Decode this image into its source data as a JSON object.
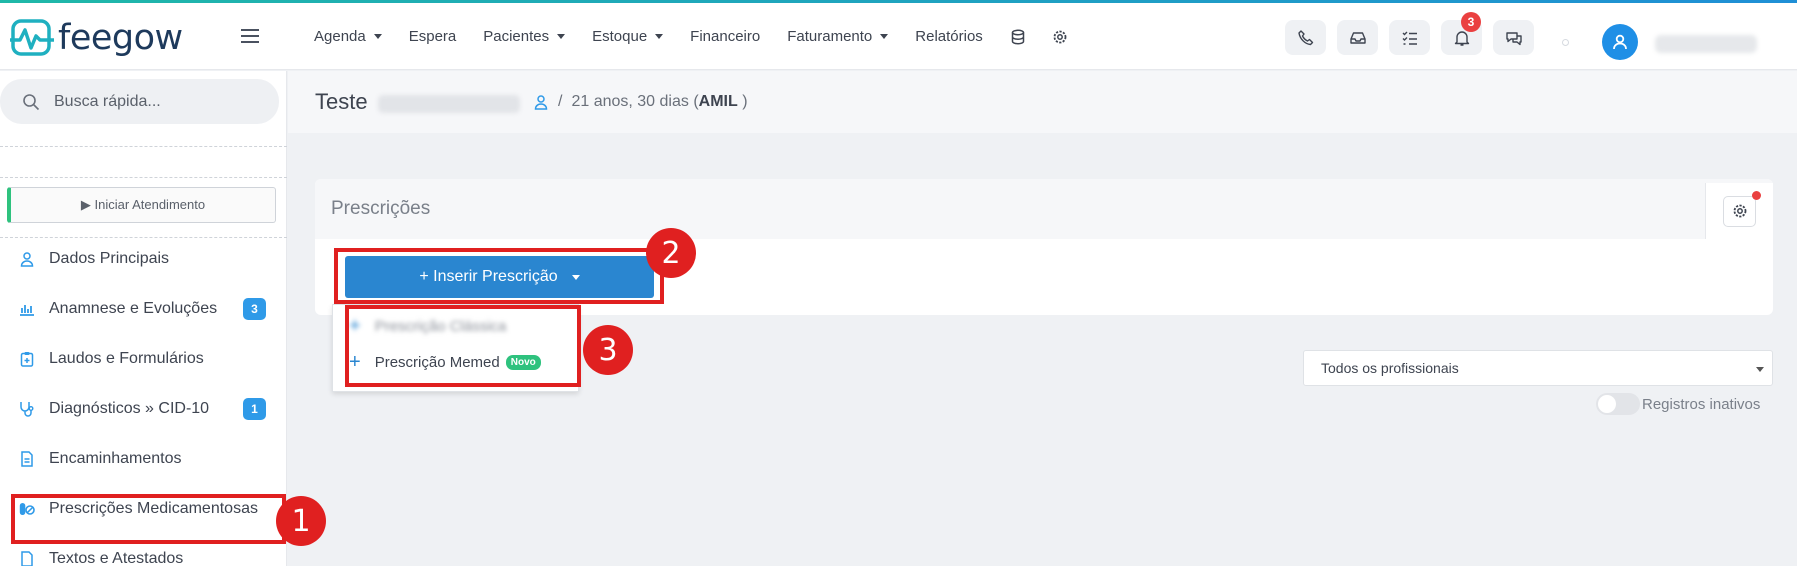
{
  "app": {
    "logo_text": "feegow"
  },
  "nav": {
    "items": [
      {
        "label": "Agenda",
        "has_caret": true
      },
      {
        "label": "Espera",
        "has_caret": false
      },
      {
        "label": "Pacientes",
        "has_caret": true
      },
      {
        "label": "Estoque",
        "has_caret": true
      },
      {
        "label": "Financeiro",
        "has_caret": false
      },
      {
        "label": "Faturamento",
        "has_caret": true
      },
      {
        "label": "Relatórios",
        "has_caret": false
      }
    ],
    "notification_count": "3"
  },
  "sidebar": {
    "search_placeholder": "Busca rápida...",
    "start_button": "▶ Iniciar Atendimento",
    "items": [
      {
        "label": "Dados Principais",
        "icon": "user-icon"
      },
      {
        "label": "Anamnese e Evoluções",
        "icon": "chart-icon",
        "badge": "3"
      },
      {
        "label": "Laudos e Formulários",
        "icon": "clipboard-icon"
      },
      {
        "label": "Diagnósticos » CID-10",
        "icon": "stethoscope-icon",
        "badge": "1"
      },
      {
        "label": "Encaminhamentos",
        "icon": "document-icon"
      },
      {
        "label": "Prescrições Medicamentosas",
        "icon": "pills-icon"
      },
      {
        "label": "Textos e Atestados",
        "icon": "document-icon"
      }
    ]
  },
  "header": {
    "patient_name": "Teste",
    "breadcrumb_sep": "/",
    "age_info": "21 anos, 30 dias (",
    "insurance": "AMIL",
    "age_suffix": " )"
  },
  "panel": {
    "title": "Prescrições",
    "insert_button": "+ Inserir Prescrição",
    "dropdown": {
      "classic_label": "Prescrição Clássica",
      "memed_label": "Prescrição Memed",
      "new_badge": "Novo"
    }
  },
  "filters": {
    "professional_select": "Todos os profissionais",
    "inactive_toggle_label": "Registros inativos"
  },
  "annotations": [
    "1",
    "2",
    "3"
  ],
  "colors": {
    "accent": "#2a86d0",
    "badge": "#2f9ae8",
    "notification": "#ea4040",
    "annotation": "#e02020",
    "new_badge": "#2ec27e"
  }
}
